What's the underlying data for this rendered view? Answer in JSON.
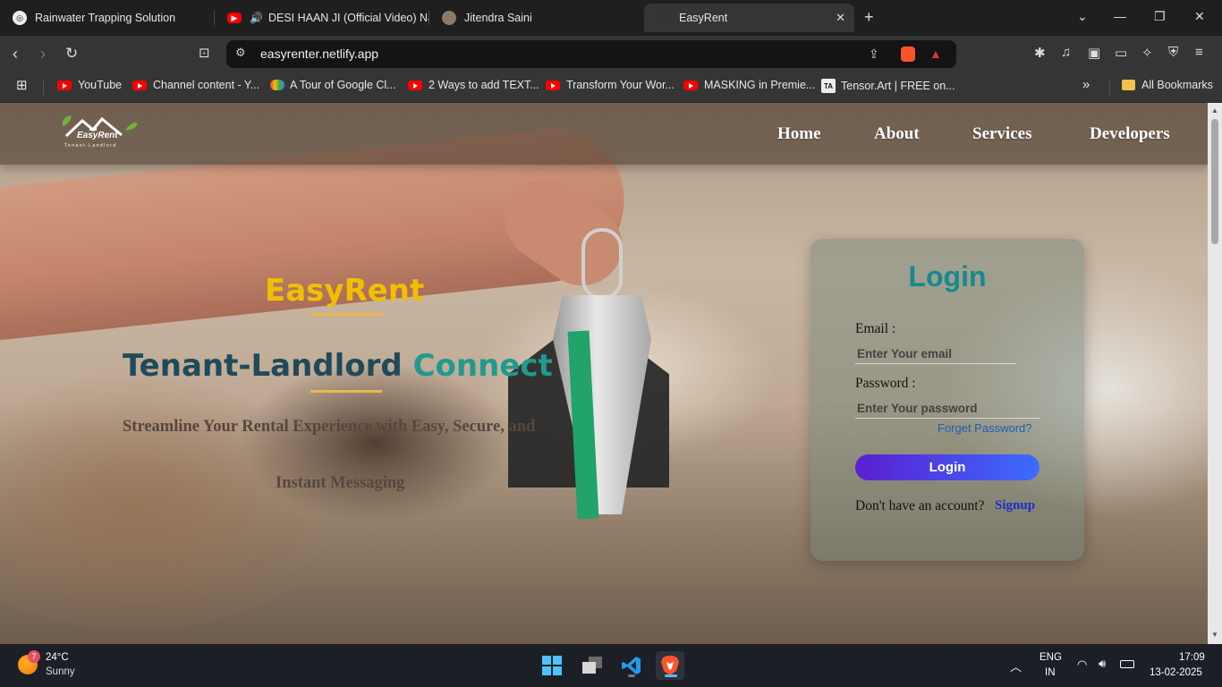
{
  "browser": {
    "tabs": [
      {
        "title": "Rainwater Trapping Solution",
        "icon": "openai-icon"
      },
      {
        "title": "DESI HAAN JI (Official Video) Na",
        "icon": "youtube-icon",
        "audio": true
      },
      {
        "title": "Jitendra Saini",
        "icon": "avatar-icon"
      },
      {
        "title": "EasyRent",
        "icon": "easyrent-icon",
        "active": true
      }
    ],
    "url": "easyrenter.netlify.app",
    "bookmarks": [
      {
        "label": "YouTube",
        "icon": "youtube-icon"
      },
      {
        "label": "Channel content - Y...",
        "icon": "youtube-icon"
      },
      {
        "label": "A Tour of Google Cl...",
        "icon": "google-cloud-icon"
      },
      {
        "label": "2 Ways to add TEXT...",
        "icon": "youtube-icon"
      },
      {
        "label": "Transform Your Wor...",
        "icon": "youtube-icon"
      },
      {
        "label": "MASKING in Premie...",
        "icon": "youtube-icon"
      },
      {
        "label": "Tensor.Art | FREE on...",
        "icon": "tensorart-icon"
      }
    ],
    "all_bookmarks": "All Bookmarks"
  },
  "site": {
    "logo_text": "EasyRent",
    "logo_sub": "Tenant-Landlord",
    "nav": [
      "Home",
      "About",
      "Services",
      "Developers"
    ],
    "hero": {
      "brand": "EasyRent",
      "tagline_part1": "Tenant-Landlord",
      "tagline_part2": "Connect",
      "subtitle_line1": "Streamline Your Rental Experience with Easy, Secure, and",
      "subtitle_line2": "Instant Messaging"
    },
    "login": {
      "title": "Login",
      "email_label": "Email :",
      "email_placeholder": "Enter Your email",
      "password_label": "Password :",
      "password_placeholder": "Enter Your password",
      "forgot": "Forget Password?",
      "button": "Login",
      "no_account": "Don't have an account?",
      "signup": "Signup"
    }
  },
  "taskbar": {
    "weather": {
      "temp": "24°C",
      "condition": "Sunny",
      "badge": "7"
    },
    "lang": "ENG",
    "region": "IN",
    "time": "17:09",
    "date": "13-02-2025"
  },
  "colors": {
    "brand_yellow": "#f0c000",
    "tagline_dark": "#1f4a5a",
    "tagline_teal": "#1f9a90",
    "login_title": "#168a8c",
    "login_button_start": "#5a1fd0",
    "login_button_end": "#3b6cff"
  }
}
